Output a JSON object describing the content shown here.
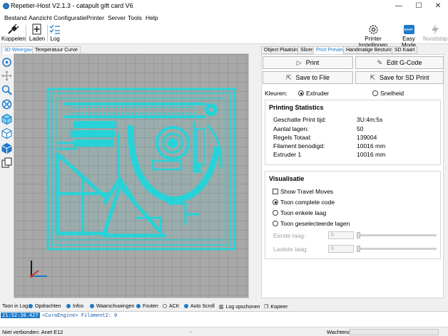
{
  "window": {
    "title": "Repetier-Host V2.1.3 - catapult gift card V6",
    "minimize": "—",
    "maximize": "☐",
    "close": "✕"
  },
  "menu": [
    "Bestand",
    "Aanzicht",
    "Configuratie",
    "Printer",
    "Server",
    "Tools",
    "Help"
  ],
  "toolbar": {
    "connect_label": "Koppelen",
    "load_label": "Laden",
    "log_label": "Log",
    "printer_settings_label": "Printer Instellingen",
    "easy_mode_label": "Easy Mode",
    "easy_badge": "EASY",
    "emergency_label": "Noodstop"
  },
  "left_tabs": [
    "3D Weergave",
    "Temperatuur Curve"
  ],
  "right_tabs": [
    "Object Plaatsing",
    "Slicer",
    "Print Preview",
    "Handmatige Besturing",
    "SD Kaart"
  ],
  "buttons": {
    "print": "Print",
    "edit_gcode": "Edit G-Code",
    "save_file": "Save to File",
    "save_sd": "Save for SD Print"
  },
  "colors_row": {
    "label": "Kleuren:",
    "option1": "Extruder",
    "option2": "Snelheid"
  },
  "printing_statistics": {
    "title": "Printing Statistics",
    "rows": [
      {
        "label": "Geschatte Print tijd:",
        "value": "3U:4m:5s"
      },
      {
        "label": "Aantal lagen:",
        "value": "50"
      },
      {
        "label": "Regels Totaal:",
        "value": "139004"
      },
      {
        "label": "Filament benodigd:",
        "value": "10016 mm"
      },
      {
        "label": "Extruder 1",
        "value": "10016 mm"
      }
    ]
  },
  "visualisation": {
    "title": "Visualisatie",
    "show_travel": "Show Travel Moves",
    "opt_complete": "Toon complete code",
    "opt_single": "Toon enkele laag",
    "opt_selected": "Toon geselecteerde lagen",
    "first_layer_label": "Eerste laag:",
    "first_layer_value": "0",
    "last_layer_label": "Laatste laag:",
    "last_layer_value": "0"
  },
  "logbar": {
    "show_label": "Toon in Log:",
    "items": [
      "Opdrachten",
      "Infos",
      "Waarschuwingen",
      "Fouten",
      "ACK",
      "Auto Scroll",
      "Log opschonen",
      "Kopieer"
    ]
  },
  "log": {
    "time": "21:52:38.427",
    "message": "<CuraEngine> Filament2: 0"
  },
  "status": {
    "connection": "Niet verbonden: Anet E12",
    "middle": "-",
    "state": "Wachtend"
  },
  "accent_color": "#1c7ac9",
  "model_color": "#27d3d8"
}
